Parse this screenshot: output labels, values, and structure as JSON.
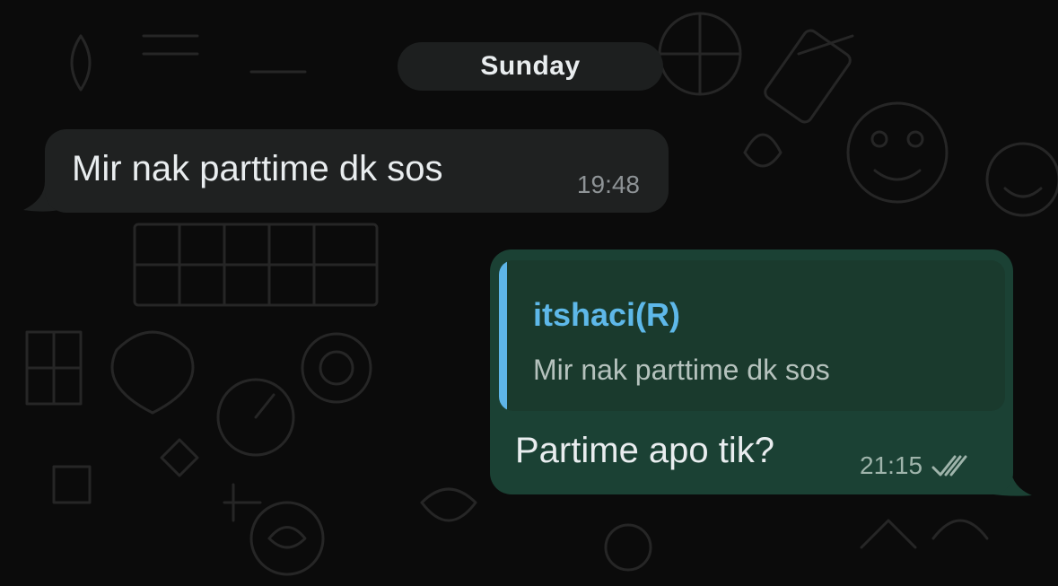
{
  "chat": {
    "date_label": "Sunday",
    "incoming": {
      "text": "Mir nak parttime dk sos",
      "time": "19:48"
    },
    "outgoing": {
      "reply_to": {
        "author": "itshaci(R)",
        "text": "Mir nak parttime dk sos"
      },
      "text": "Partime apo tik?",
      "time": "21:15",
      "status_icon": "double-check-icon"
    }
  },
  "colors": {
    "background": "#0b0b0b",
    "incoming_bubble": "#1f2121",
    "outgoing_bubble": "#1b4134",
    "quote_bar": "#5eb5e8",
    "quote_author": "#5eb8e9"
  }
}
